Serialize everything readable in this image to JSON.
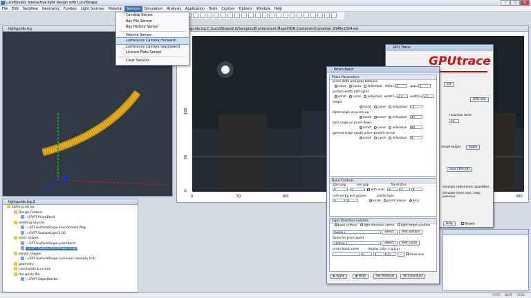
{
  "window": {
    "title": "LucidStudio: Interactive light design with LucidShape"
  },
  "menubar": [
    "File",
    "Edit",
    "GeoView",
    "Geometry",
    "FunGeo",
    "Light Sources",
    "Material",
    "Sensors",
    "Simulation",
    "Analysis",
    "Application",
    "Tests",
    "Custom",
    "Options",
    "Window",
    "Help"
  ],
  "sensors_menu": {
    "items": [
      "Candela Sensor",
      "Ray File Sensor",
      "Ray History Sensor",
      "Volume Sensor",
      "Luminance Camera (forward)",
      "Luminance Camera (backward)",
      "License Plate Sensor",
      "Clear Sensors"
    ],
    "highlighted": "Luminance Camera (forward)"
  },
  "geoview": {
    "title": "lightguide.lsg"
  },
  "env_view": {
    "title": "lightguide.lsg   C:/LucidShape2.0/Samples/Environment Maps/HDR Container/Container 2048x1024.exr",
    "xticks": [
      "0",
      "50",
      "100",
      "150",
      "200",
      "250",
      "300",
      "360"
    ],
    "yticks": [
      "100",
      "50",
      "0"
    ]
  },
  "tree": {
    "title": "lightguide.lsg:2",
    "items": [
      {
        "t": "lighting set up",
        "lvl": 0
      },
      {
        "t": "Design Feature",
        "lvl": 1
      },
      {
        "t": ":=EVPT PrismBand",
        "lvl": 2
      },
      {
        "t": "emitting sources",
        "lvl": 1
      },
      {
        "t": ":=VPT SurfaceShape   Environment Map",
        "lvl": 2
      },
      {
        "t": ":=EVPT SurfaceLight   1.00",
        "lvl": 2
      },
      {
        "t": "actor shapes",
        "lvl": 1
      },
      {
        "t": ":=VPT SurfaceShape   prismband",
        "lvl": 2
      },
      {
        "t": ":=EVPT MultiSurfaceShape   shape",
        "lvl": 2,
        "sel": true
      },
      {
        "t": "sensor shapes",
        "lvl": 1
      },
      {
        "t": ":=VPT SurfaceShape   Luminous Intensity (cd)",
        "lvl": 2
      },
      {
        "t": "geometry",
        "lvl": 1
      },
      {
        "t": "commands & scripts",
        "lvl": 1
      },
      {
        "t": "the whole file ...",
        "lvl": 1
      },
      {
        "t": ":=EVPT ObjectVector",
        "lvl": 2
      }
    ]
  },
  "gputrace": {
    "title": "GPU Trace",
    "logo": "GPUtrace",
    "buttons": {
      "b1": "set",
      "b2": "GPU info",
      "apply": "Apply",
      "max": "max CPUs (8)",
      "help": "Help",
      "details": "Details"
    },
    "labels": {
      "recursion": "recursion level",
      "recursion_val": "64",
      "choose": "chood height",
      "sim1": "simulate radiometric quantities",
      "sim2": "simulate more rays; keep previous"
    }
  },
  "prism": {
    "title": "Prism Band",
    "params_head": "Prism Parameters",
    "prism_delta": "prism delta and gaps between",
    "const": "const",
    "curve": "curve",
    "individual": "individual",
    "delta_lbl": "delta=",
    "delta_val": "2",
    "gap_lbl": "gap=",
    "gap_val": "1",
    "surface_width": "surface width (left,right)",
    "w1_lbl": "width1=",
    "w1_val": "2.5",
    "w2_lbl": "width2=",
    "w2_val": "2.5",
    "height": "height",
    "height_val": "-3",
    "alpha": "alpha angle on prism up",
    "alpha_val": "30",
    "beta": "beta angle on prism down",
    "beta_val": "80",
    "gamma": "gamma angle rotate prism around normal",
    "gamma_val": "0",
    "band_head": "Band Controls",
    "start_gap": "start gap",
    "end_gap": "end gap",
    "translation": "Translation",
    "sg_val": "0",
    "eg_val": "0",
    "with_ends": "with ends",
    "t1": "0",
    "t2": "0",
    "t3": "0",
    "radii": "radii on tip and groove",
    "profile": "profile type",
    "r1": "0",
    "r2": "0",
    "prism_opt": "prism",
    "prism_planar": "prism planar",
    "arcv": "arcv",
    "light_head": "Light Direction Controls",
    "base_surface": "base surface",
    "light_dir": "light direction vector",
    "light_target": "light target position",
    "sweep": "Sweep 2",
    "select": "select..",
    "test_surface": "Test surface",
    "spine": "Spine for prism band",
    "contino": "Contino 1",
    "test_curve": "Test curve",
    "band_name": "prism band name",
    "display_color": "display color (r,g,b,a)",
    "name_val": "",
    "c1": "0",
    "c2": "0",
    "c3": "0.5",
    "show_axis": "show axis",
    "apply": "Apply",
    "help": "Help",
    "set_material": "Set Material",
    "all_individual": "All Individual"
  },
  "status": {
    "caps": "CAPS",
    "num": "NUM",
    "scrl": "SCRL"
  },
  "colors": {
    "accent": "#3c6fb0",
    "red_logo": "#d01010"
  }
}
